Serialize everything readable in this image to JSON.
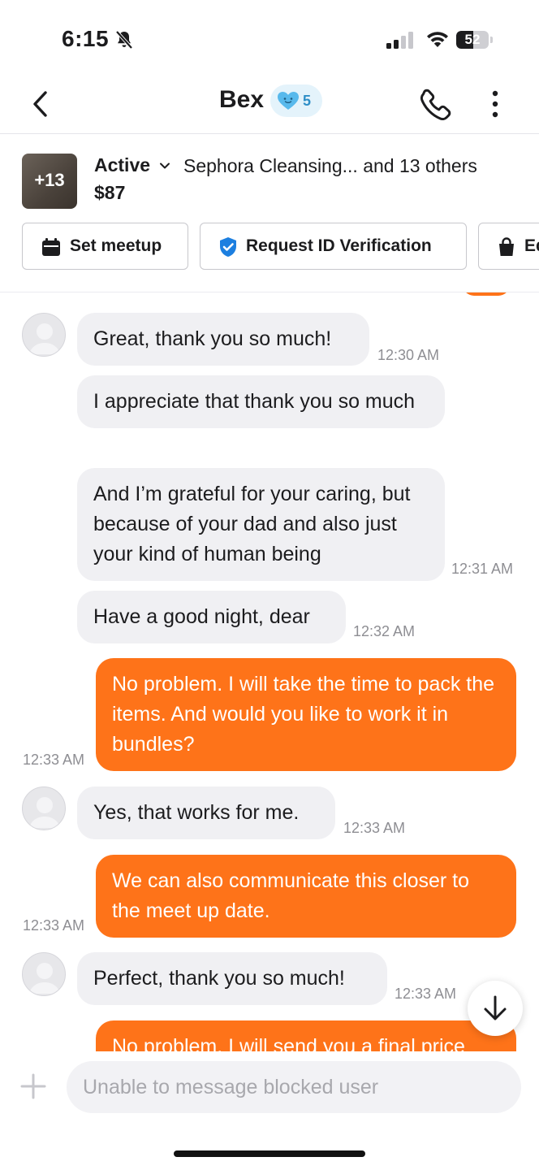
{
  "status_bar": {
    "time": "6:15",
    "battery": "52",
    "battery_level": 0.52
  },
  "header": {
    "title": "Bex",
    "badge_count": "5",
    "icons": [
      "back-chevron-icon",
      "heart-face-icon",
      "phone-icon",
      "more-vertical-icon"
    ]
  },
  "listing": {
    "thumb_label": "+13",
    "status": "Active",
    "title": "Sephora Cleansing... and 13 others",
    "price": "$87"
  },
  "actions": [
    {
      "label": "Set meetup",
      "icon": "calendar-icon"
    },
    {
      "label": "Request ID Verification",
      "icon": "shield-check-icon"
    },
    {
      "label": "Ed",
      "icon": "shopping-bag-icon"
    }
  ],
  "messages": [
    {
      "side": "in",
      "text": "Great, thank you so much!",
      "time": "12:30 AM"
    },
    {
      "side": "in",
      "text": "I appreciate that thank you so much",
      "time": ""
    },
    {
      "side": "in",
      "text": "And I’m grateful for your caring, but because of your dad and also just your kind of human being",
      "time": "12:31 AM"
    },
    {
      "side": "in",
      "text": "Have a good night, dear",
      "time": "12:32 AM"
    },
    {
      "side": "out",
      "text": "No problem. I will take the time to pack the items. And would you like to work it in bundles?",
      "time": "12:33 AM"
    },
    {
      "side": "in",
      "text": "Yes, that works for me.",
      "time": "12:33 AM"
    },
    {
      "side": "out",
      "text": "We can also communicate this closer to the meet up date.",
      "time": "12:33 AM"
    },
    {
      "side": "in",
      "text": "Perfect, thank you so much!",
      "time": "12:33 AM"
    },
    {
      "side": "out",
      "text": "No problem. I will send you a final price",
      "time": ""
    }
  ],
  "composer": {
    "placeholder": "Unable to message blocked user"
  },
  "colors": {
    "outgoing_bubble": "#fe7319",
    "incoming_bubble": "#f0f0f3",
    "badge_blue": "#2f8fc7"
  }
}
